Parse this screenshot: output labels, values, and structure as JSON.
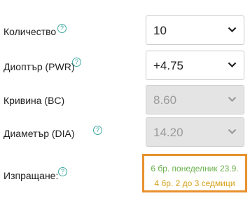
{
  "fields": [
    {
      "label": "Количество",
      "value": "10",
      "disabled": false
    },
    {
      "label": "Диоптър (PWR)",
      "value": "+4.75",
      "disabled": false
    },
    {
      "label": "Кривина (BC)",
      "value": "8.60",
      "disabled": true
    },
    {
      "label": "Диаметър (DIA)",
      "value": "14.20",
      "disabled": true
    }
  ],
  "help_glyph": "?",
  "shipping": {
    "label": "Изпращане:",
    "line1": "6 бр. понеделник 23.9.",
    "line2": "4 бр. 2 до 3 седмици"
  },
  "colors": {
    "help_icon": "#3fa9a1",
    "highlight_border": "#e8912d",
    "in_stock_text": "#6ab04c",
    "delayed_text": "#d4a017",
    "disabled_bg": "#e4e4e4"
  }
}
